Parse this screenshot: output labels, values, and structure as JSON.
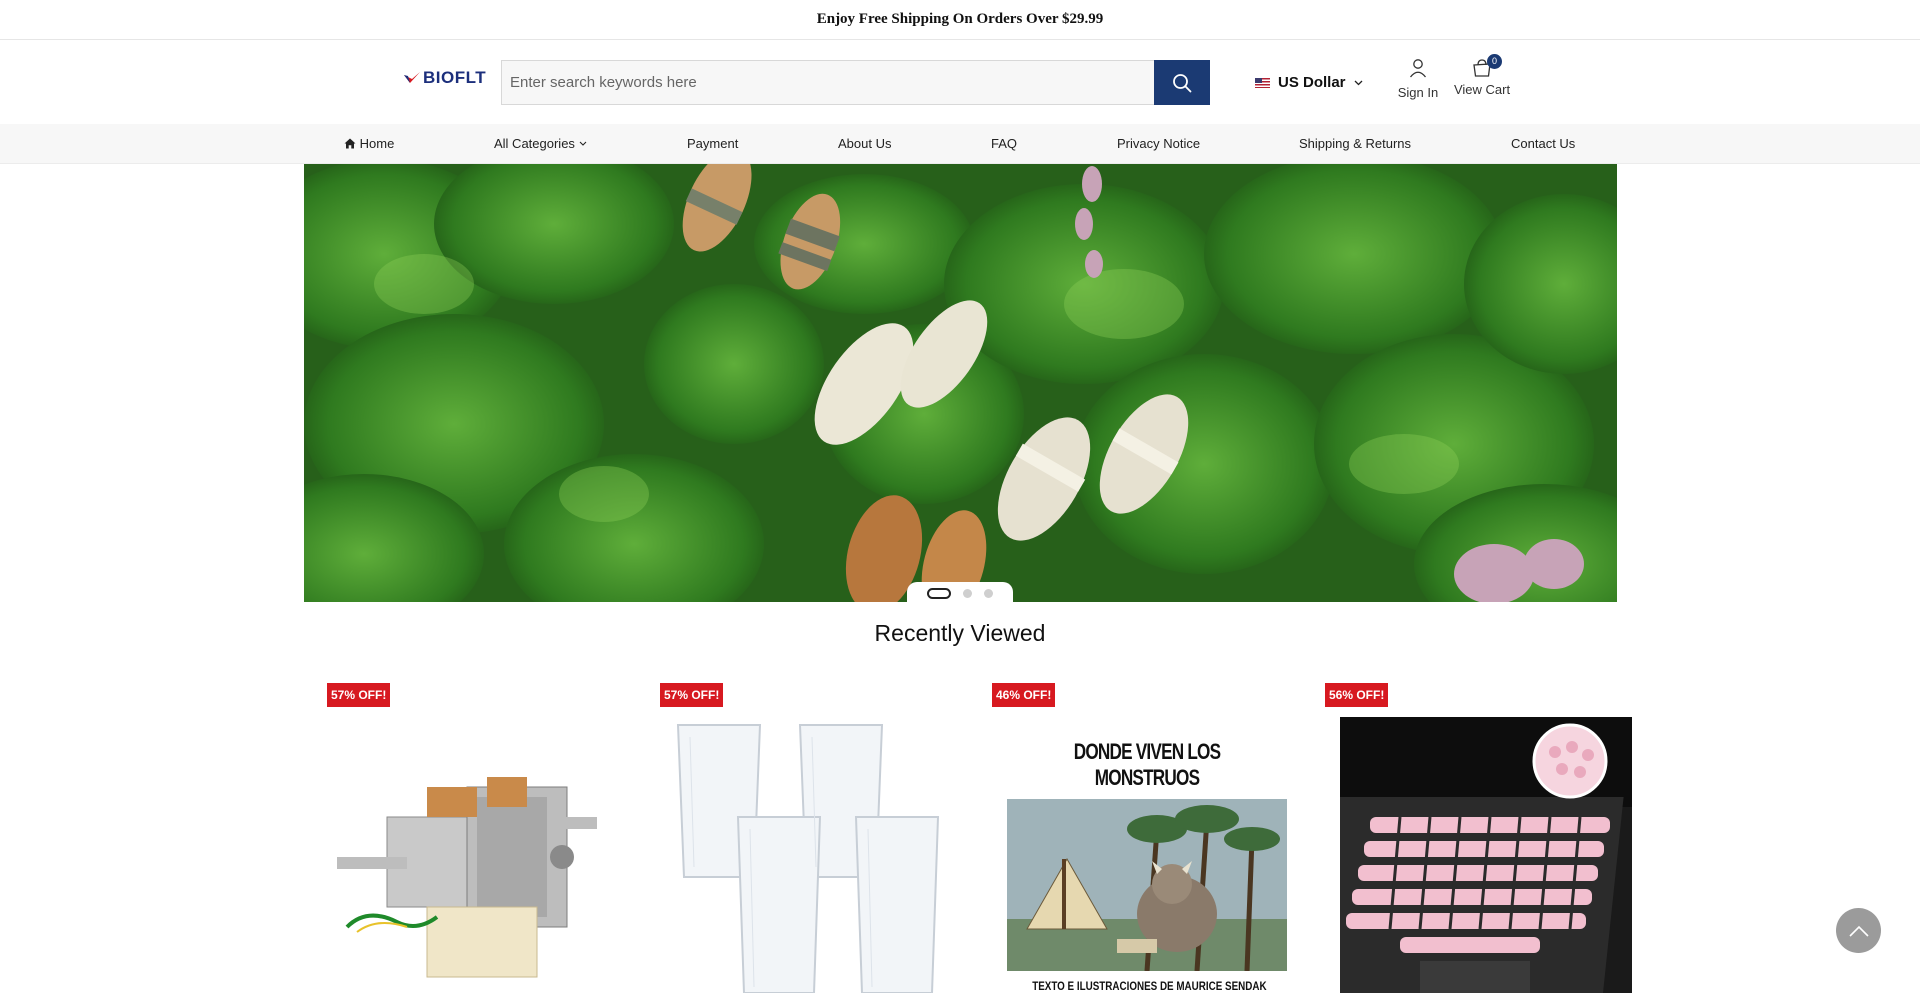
{
  "topbar": {
    "announcement": "Enjoy Free Shipping On Orders Over $29.99"
  },
  "header": {
    "logo_text": "BIOFLT",
    "search_placeholder": "Enter search keywords here",
    "currency": "US Dollar",
    "sign_in": "Sign In",
    "view_cart": "View Cart",
    "cart_count": "0"
  },
  "nav": {
    "items": [
      {
        "label": "Home",
        "icon": "home-icon"
      },
      {
        "label": "All Categories",
        "icon": "chevron-down-icon"
      },
      {
        "label": "Payment"
      },
      {
        "label": "About Us"
      },
      {
        "label": "FAQ"
      },
      {
        "label": "Privacy Notice"
      },
      {
        "label": "Shipping & Returns"
      },
      {
        "label": "Contact Us"
      }
    ]
  },
  "banner": {
    "active_slide": 1,
    "slide_count": 3
  },
  "recently_viewed": {
    "title": "Recently Viewed",
    "products": [
      {
        "discount": "57% OFF!",
        "image": "fan-motor"
      },
      {
        "discount": "57% OFF!",
        "image": "tumblers"
      },
      {
        "discount": "46% OFF!",
        "image": "book-cover",
        "cover_title": "DONDE VIVEN LOS MONSTRUOS",
        "cover_subtitle": "TEXTO E ILUSTRACIONES DE MAURICE SENDAK"
      },
      {
        "discount": "56% OFF!",
        "image": "keyboard-cover"
      }
    ]
  },
  "colors": {
    "brand_blue": "#1b3a73",
    "discount_red": "#d71920"
  }
}
